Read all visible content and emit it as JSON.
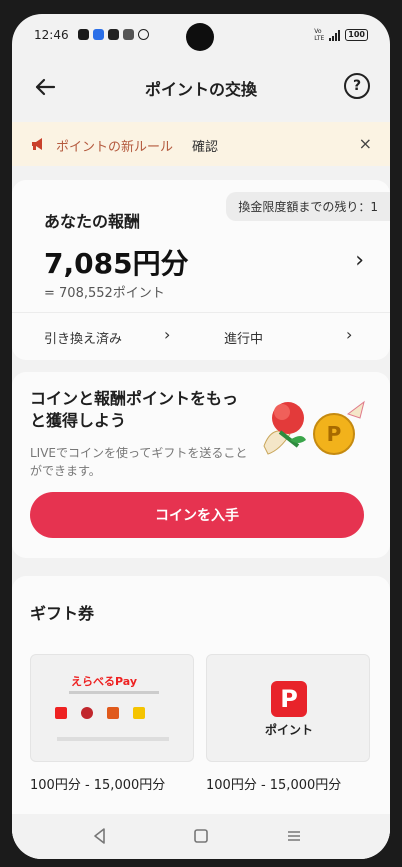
{
  "status_bar": {
    "time": "12:46",
    "network": "Vo LTE",
    "battery": "100"
  },
  "header": {
    "title": "ポイントの交換",
    "help_label": "?"
  },
  "banner": {
    "text": "ポイントの新ルール",
    "link": "確認",
    "close": "×"
  },
  "rewards": {
    "label": "あなたの報酬",
    "limit_text": "換金限度額までの残り：1",
    "amount": "7,085円分",
    "points": "= 708,552ポイント",
    "link_exchanged": "引き換え済み",
    "link_in_progress": "進行中",
    "chevron": "›"
  },
  "promo": {
    "heading": "コインと報酬ポイントをもっと獲得しよう",
    "body": "LIVEでコインを使ってギフトを送ることができます。",
    "button": "コインを入手"
  },
  "gift": {
    "title": "ギフト券",
    "cards": [
      {
        "name": "えらべるPay",
        "price": "100円分 - 15,000円分"
      },
      {
        "name": "ポイント",
        "logo_letter": "P",
        "price": "100円分 - 15,000円分"
      }
    ]
  },
  "colors": {
    "accent": "#e63350",
    "banner_bg": "#fbf3e3",
    "banner_text": "#b45a3e",
    "paypay_red": "#e8232a"
  }
}
